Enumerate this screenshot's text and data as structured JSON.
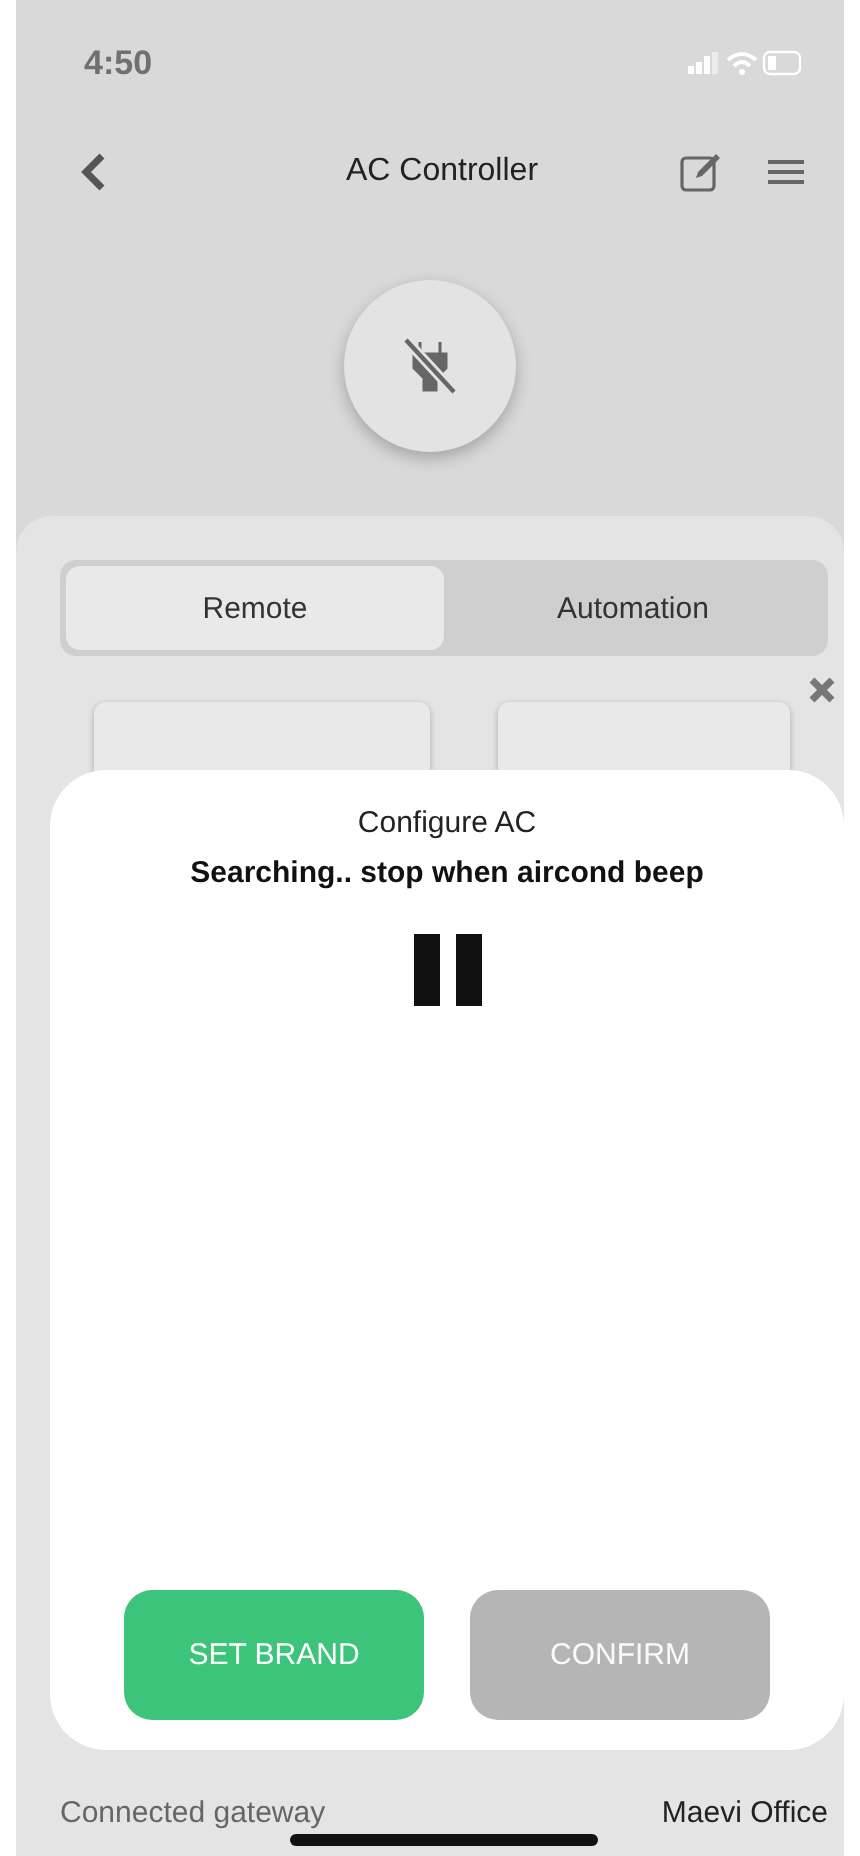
{
  "status_bar": {
    "time": "4:50"
  },
  "nav": {
    "title": "AC Controller"
  },
  "device": {
    "connected": false
  },
  "tabs": [
    {
      "label": "Remote",
      "selected": true
    },
    {
      "label": "Automation",
      "selected": false
    }
  ],
  "dialog": {
    "title": "Configure AC",
    "message": "Searching.. stop when aircond beep",
    "paused": true,
    "buttons": [
      {
        "label": "SET BRAND",
        "disabled": false
      },
      {
        "label": "CONFIRM",
        "disabled": true
      }
    ]
  },
  "footer": {
    "label": "Connected gateway",
    "value": "Maevi Office"
  }
}
